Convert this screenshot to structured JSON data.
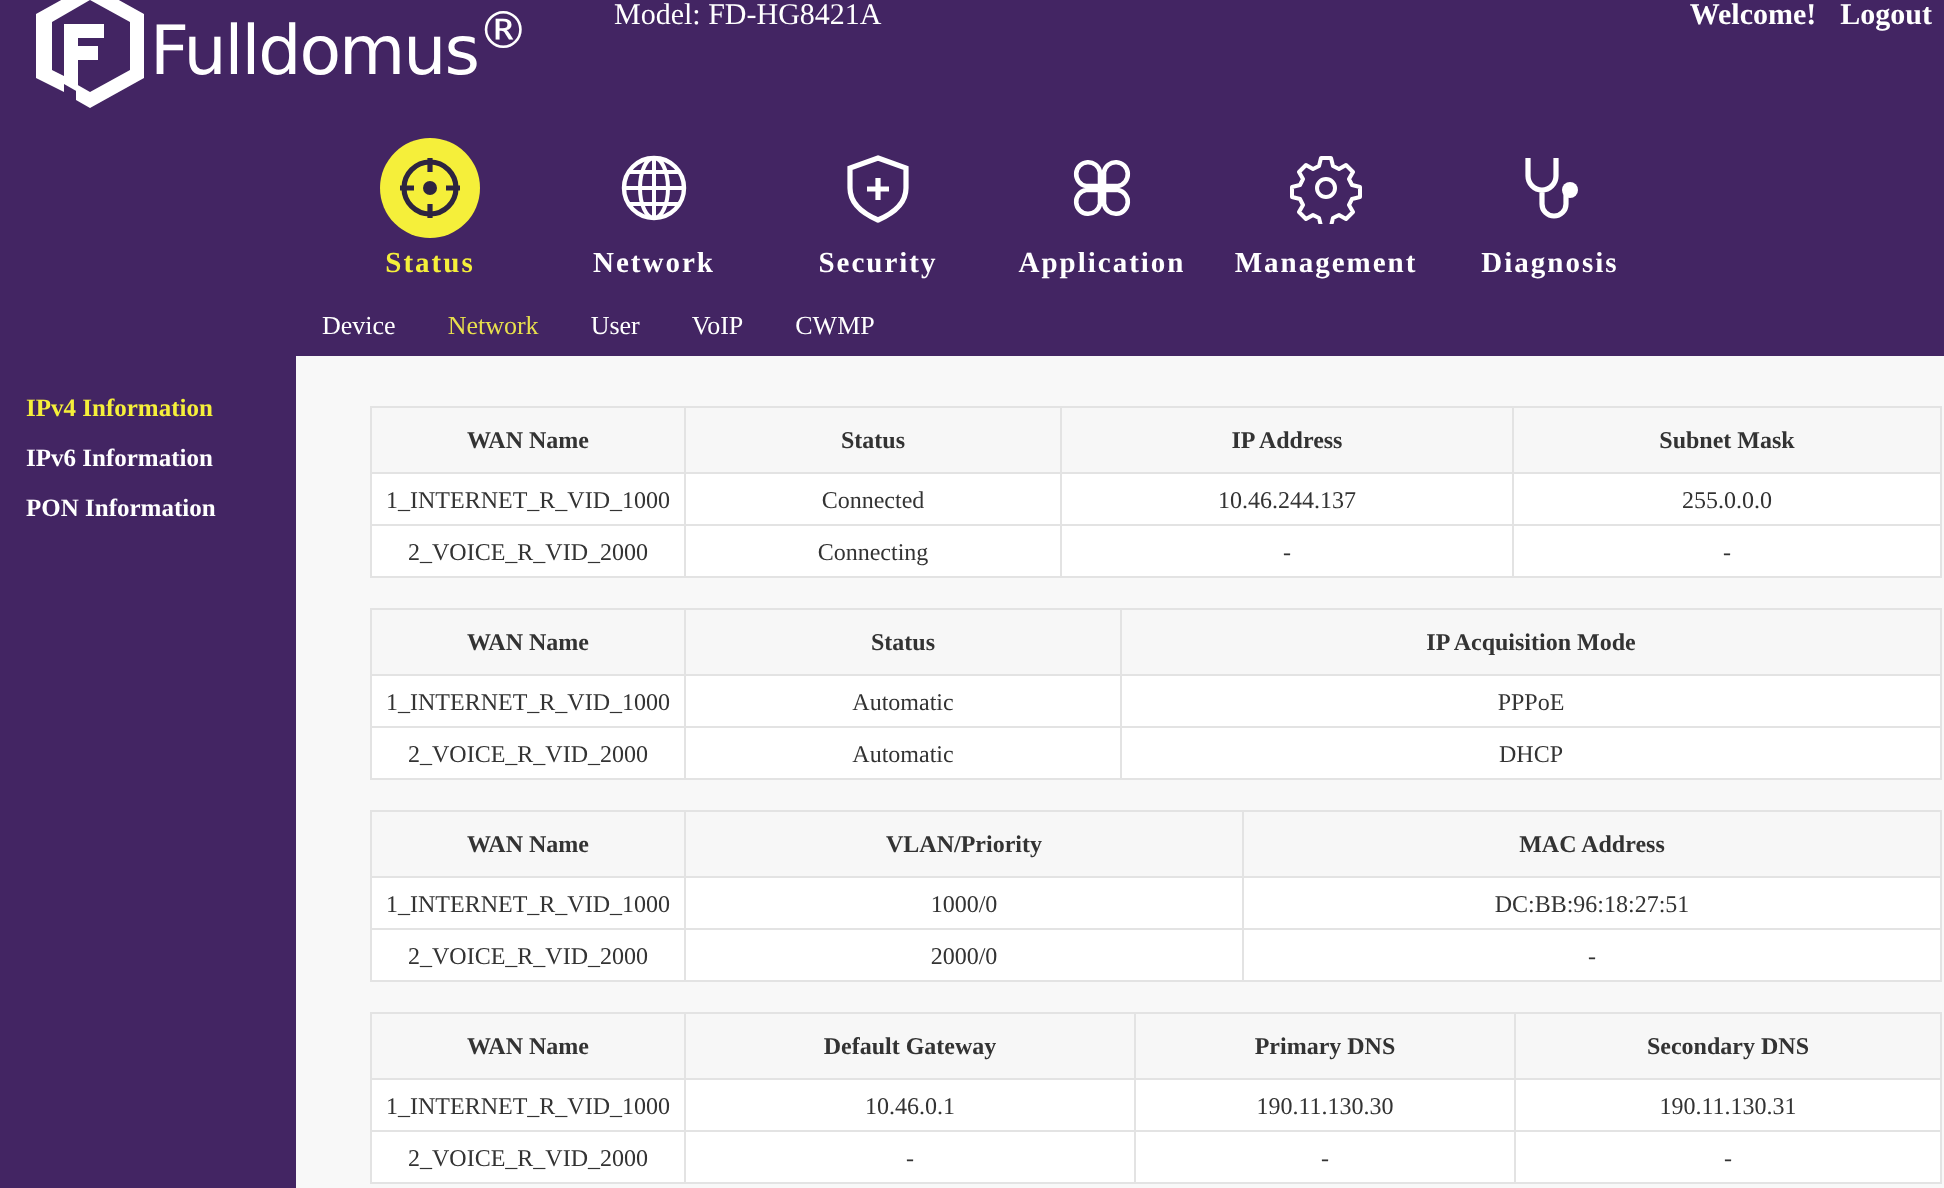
{
  "header": {
    "logo": "Fulldomus$^{®}$",
    "model": "Model: FD-HG8421A",
    "welcome": "Welcome!",
    "logout": "Logout"
  },
  "nav": [
    {
      "label": "Status",
      "kind": "target",
      "selected": true
    },
    {
      "label": "Network",
      "kind": "globe",
      "selected": false
    },
    {
      "label": "Security",
      "kind": "shield",
      "selected": false
    },
    {
      "label": "Application",
      "kind": "clover",
      "selected": false
    },
    {
      "label": "Management",
      "kind": "gear",
      "selected": false
    },
    {
      "label": "Diagnosis",
      "kind": "stethoscope",
      "selected": false
    }
  ],
  "subnav": [
    {
      "label": "Device",
      "selected": false
    },
    {
      "label": "Network",
      "selected": true
    },
    {
      "label": "User",
      "selected": false
    },
    {
      "label": "VoIP",
      "selected": false
    },
    {
      "label": "CWMP",
      "selected": false
    }
  ],
  "sidebar": [
    {
      "label": "IPv4 Information",
      "selected": true
    },
    {
      "label": "IPv6 Information",
      "selected": false
    },
    {
      "label": "PON Information",
      "selected": false
    }
  ],
  "tables": [
    {
      "columns": [
        "WAN Name",
        "Status",
        "IP Address",
        "Subnet Mask"
      ],
      "rows": [
        [
          "1_INTERNET_R_VID_1000",
          "Connected",
          "10.46.244.137",
          "255.0.0.0"
        ],
        [
          "2_VOICE_R_VID_2000",
          "Connecting",
          "-",
          "-"
        ]
      ]
    },
    {
      "columns": [
        "WAN Name",
        "Status",
        "IP Acquisition Mode"
      ],
      "rows": [
        [
          "1_INTERNET_R_VID_1000",
          "Automatic",
          "PPPoE"
        ],
        [
          "2_VOICE_R_VID_2000",
          "Automatic",
          "DHCP"
        ]
      ]
    },
    {
      "columns": [
        "WAN Name",
        "VLAN/Priority",
        "MAC Address"
      ],
      "rows": [
        [
          "1_INTERNET_R_VID_1000",
          "1000/0",
          "DC:BB:96:18:27:51"
        ],
        [
          "2_VOICE_R_VID_2000",
          "2000/0",
          "-"
        ]
      ]
    },
    {
      "columns": [
        "WAN Name",
        "Default Gateway",
        "Primary DNS",
        "Secondary DNS"
      ],
      "rows": [
        [
          "1_INTERNET_R_VID_1000",
          "10.46.0.1",
          "190.11.130.30",
          "190.11.130.31"
        ],
        [
          "2_VOICE_R_VID_2000",
          "-",
          "-",
          "-"
        ]
      ]
    }
  ]
}
